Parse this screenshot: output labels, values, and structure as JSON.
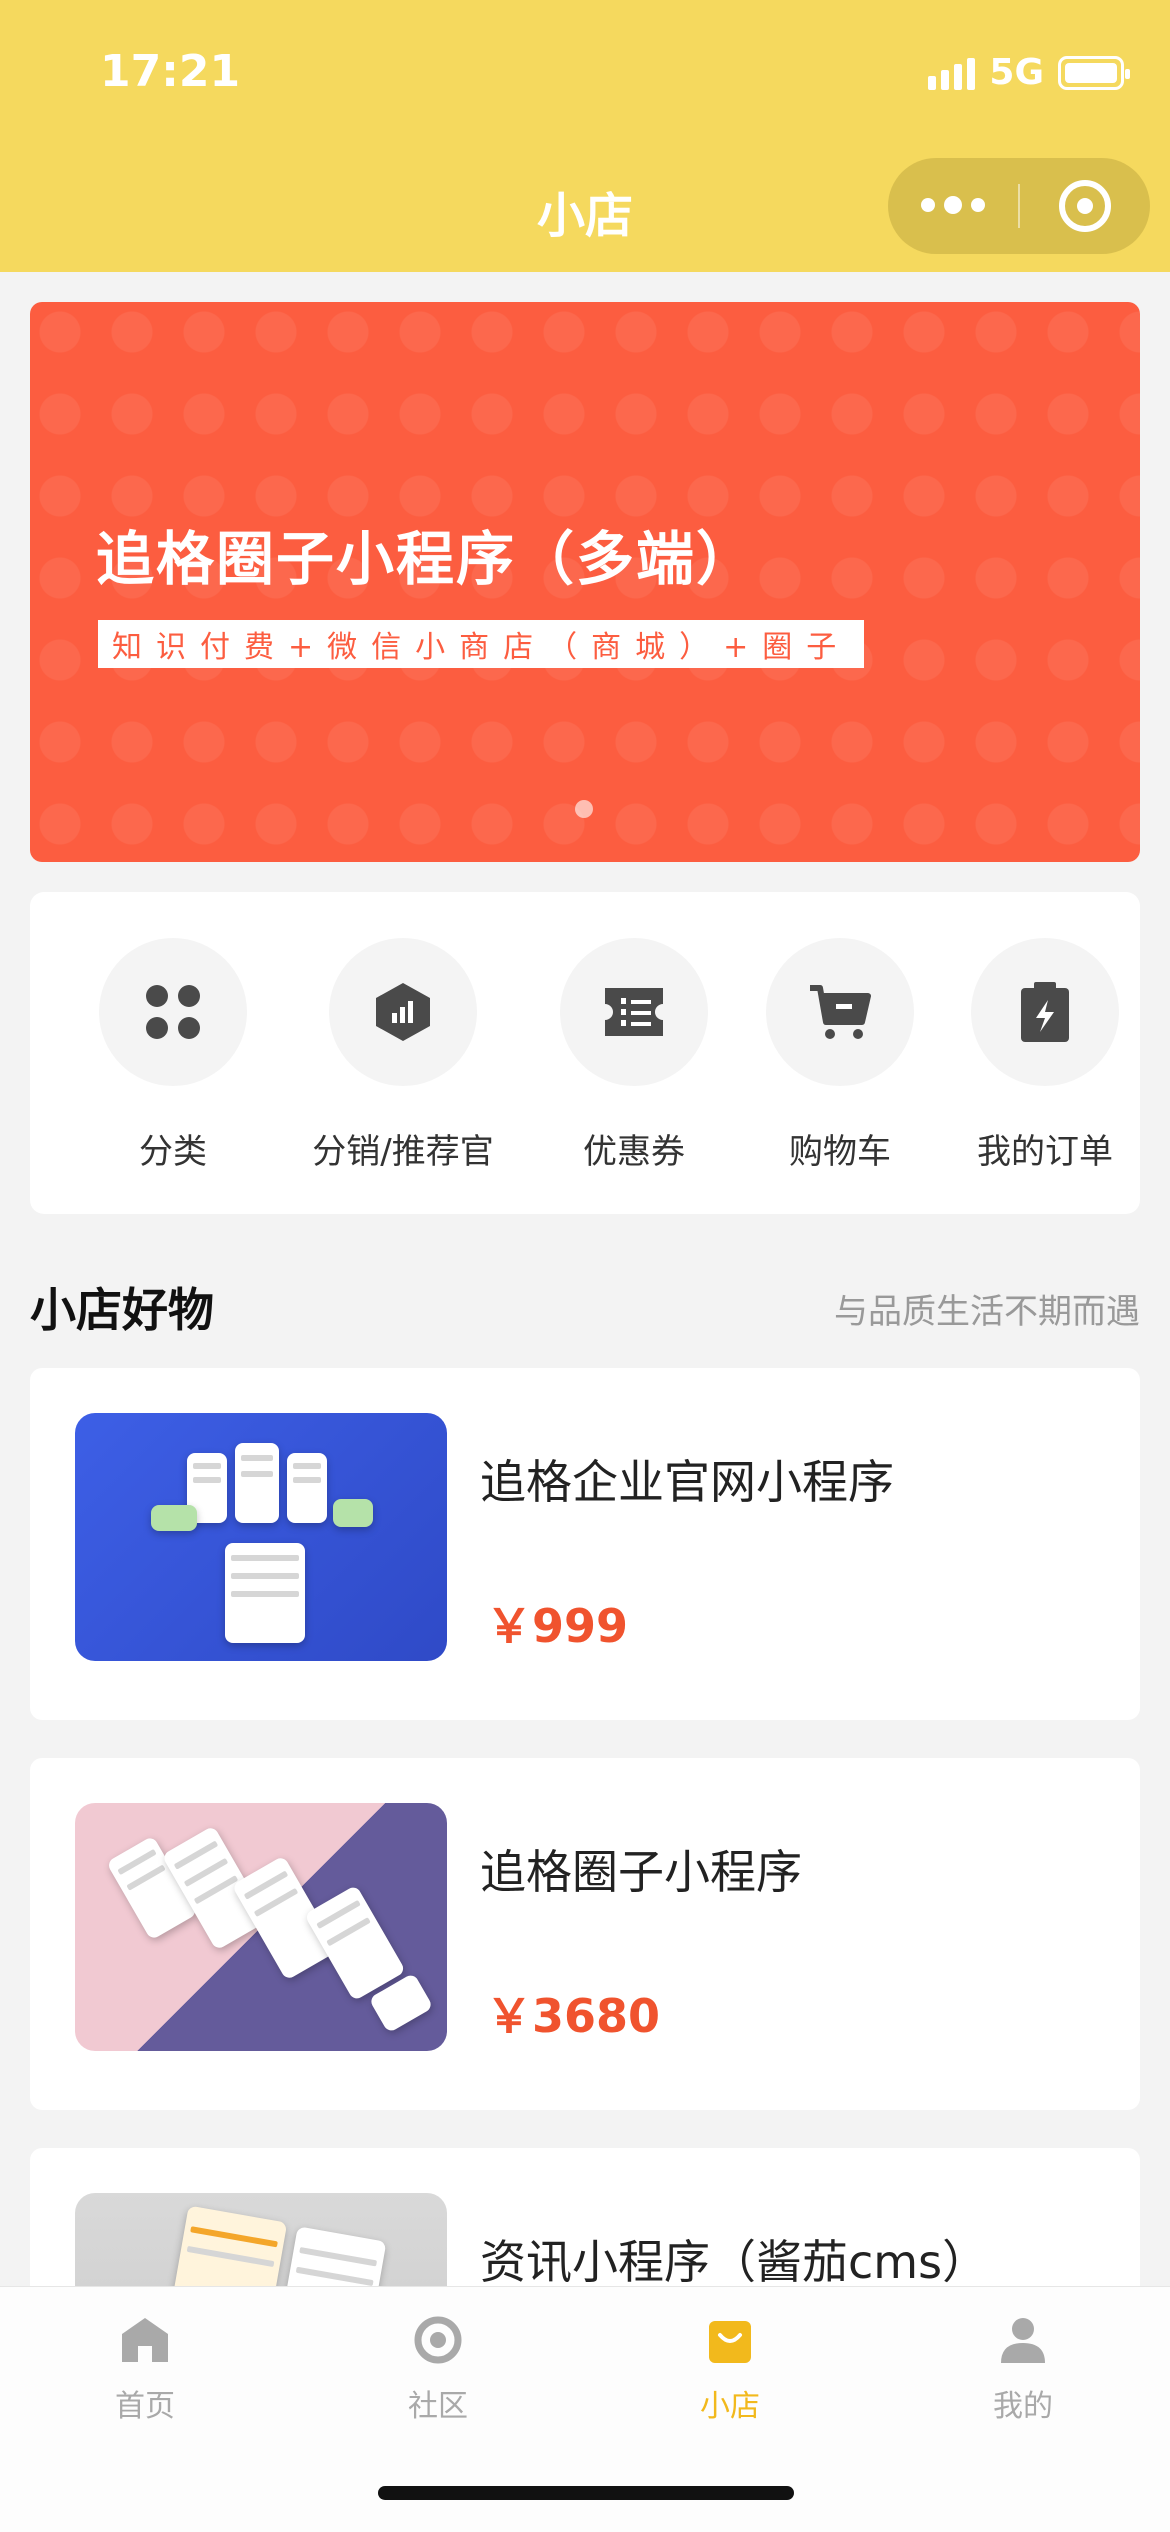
{
  "status_bar": {
    "time": "17:21",
    "network": "5G"
  },
  "nav": {
    "title": "小店"
  },
  "banner": {
    "title": "追格圈子小程序（多端）",
    "subtitle": "知识付费+微信小商店（商城）+圈子"
  },
  "quick_menu": [
    {
      "label": "分类",
      "icon": "grid-icon"
    },
    {
      "label": "分销/推荐官",
      "icon": "chart-hexagon-icon"
    },
    {
      "label": "优惠券",
      "icon": "ticket-icon"
    },
    {
      "label": "购物车",
      "icon": "cart-icon"
    },
    {
      "label": "我的订单",
      "icon": "clipboard-icon"
    }
  ],
  "section": {
    "title": "小店好物",
    "subtitle": "与品质生活不期而遇"
  },
  "products": [
    {
      "name": "追格企业官网小程序",
      "price": "￥999"
    },
    {
      "name": "追格圈子小程序",
      "price": "￥3680"
    },
    {
      "name": "资讯小程序（酱茄cms）",
      "price": ""
    }
  ],
  "tabs": [
    {
      "label": "首页",
      "icon": "home-icon",
      "active": false
    },
    {
      "label": "社区",
      "icon": "circle-icon",
      "active": false
    },
    {
      "label": "小店",
      "icon": "shop-bag-icon",
      "active": true
    },
    {
      "label": "我的",
      "icon": "user-icon",
      "active": false
    }
  ],
  "colors": {
    "header": "#f5d95e",
    "banner": "#fc5d40",
    "price": "#f0532e",
    "tab_active": "#f2b91c",
    "tab_inactive": "#a9a9a9"
  }
}
